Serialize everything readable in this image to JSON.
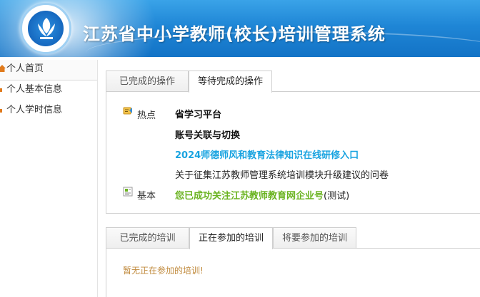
{
  "header": {
    "title": "江苏省中小学教师(校长)培训管理系统"
  },
  "sidebar": {
    "items": [
      {
        "label": "个人首页"
      },
      {
        "label": "个人基本信息"
      },
      {
        "label": "个人学时信息"
      }
    ]
  },
  "ops_tabs": [
    {
      "label": "已完成的操作",
      "active": false
    },
    {
      "label": "等待完成的操作",
      "active": true
    }
  ],
  "hot": {
    "label": "热点",
    "links": [
      "省学习平台",
      "账号关联与切换",
      "2024师德师风和教育法律知识在线研修入口",
      "关于征集江苏教师管理系统培训模块升级建议的问卷"
    ]
  },
  "basic": {
    "label": "基本",
    "link": "您已成功关注江苏教师教育网企业号",
    "suffix": "(测试)"
  },
  "training_tabs": [
    {
      "label": "已完成的培训",
      "active": false
    },
    {
      "label": "正在参加的培训",
      "active": true
    },
    {
      "label": "将要参加的培训",
      "active": false
    }
  ],
  "training_empty": "暂无正在参加的培训!",
  "colors": {
    "banner": "#1f86d6",
    "link_blue": "#18a3e0",
    "link_green": "#6ab320",
    "accent_orange": "#e07a1c"
  }
}
